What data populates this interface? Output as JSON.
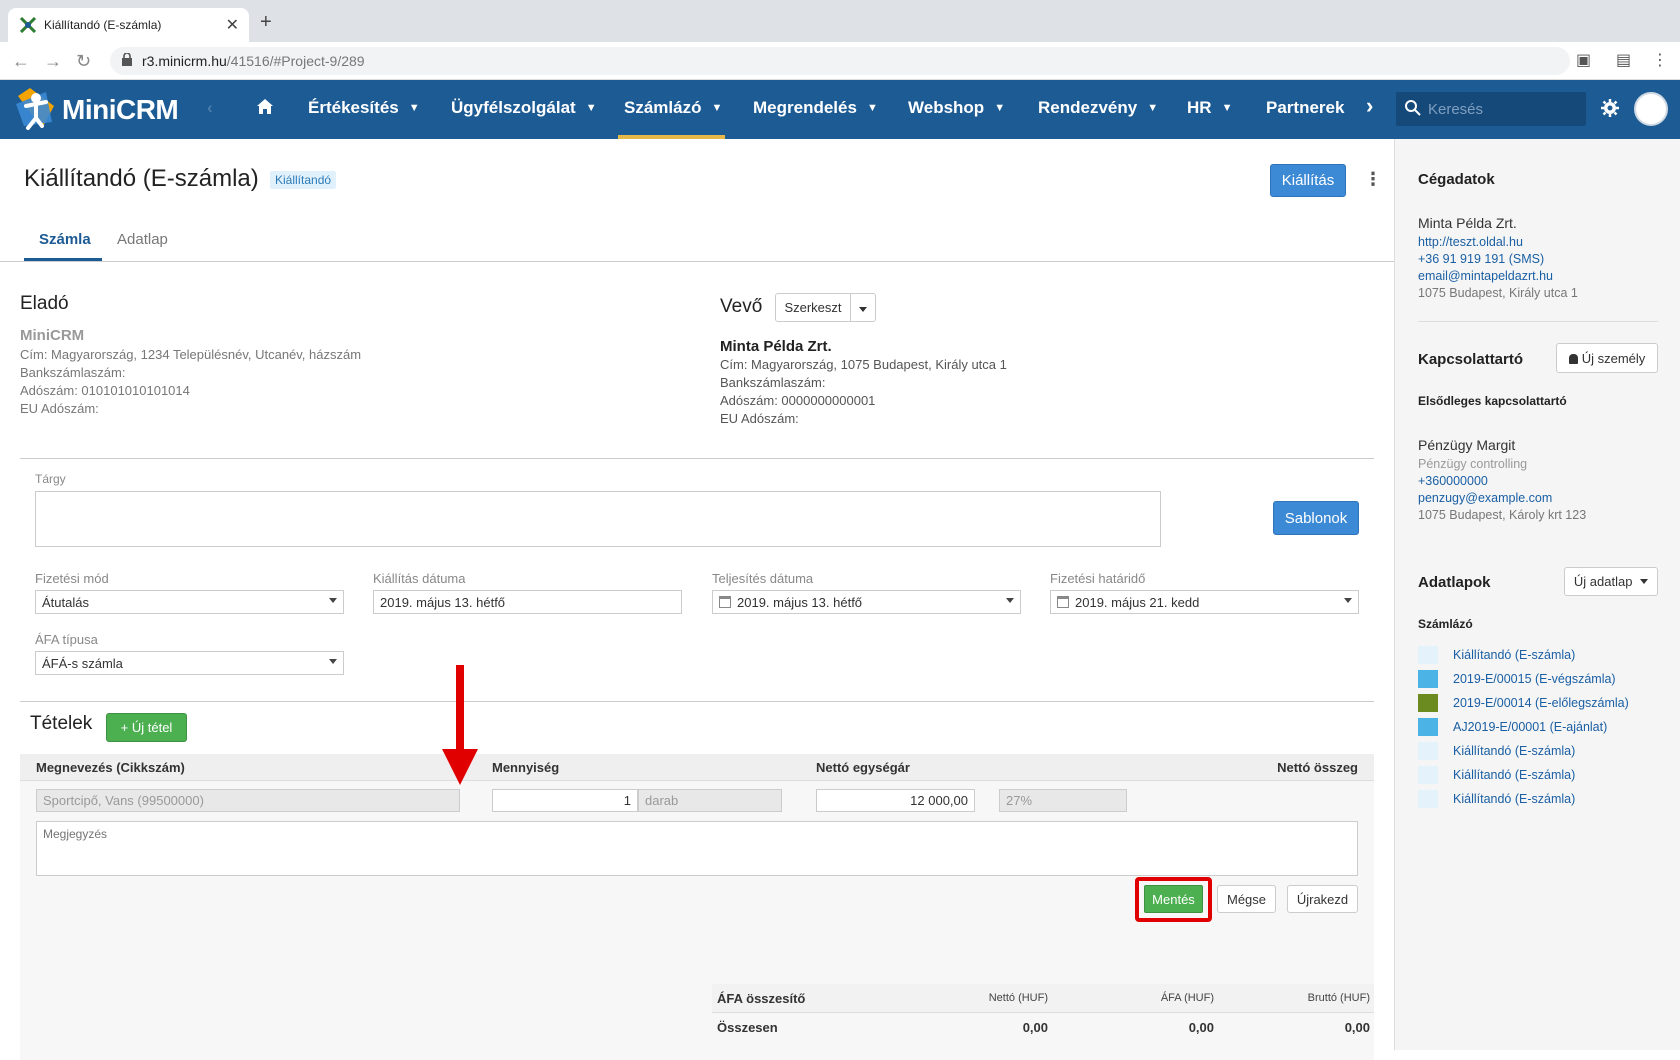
{
  "browser": {
    "tab_title": "Kiállítandó (E-számla)",
    "url_host": "r3.minicrm.hu",
    "url_path": "/41516/#Project-9/289"
  },
  "nav": {
    "logo": "MiniCRM",
    "items": [
      "Értékesítés",
      "Ügyfélszolgálat",
      "Számlázó",
      "Megrendelés",
      "Webshop",
      "Rendezvény",
      "HR",
      "Partnerek"
    ],
    "search_placeholder": "Keresés"
  },
  "page": {
    "title": "Kiállítandó (E-számla)",
    "status_badge": "Kiállítandó",
    "issue_button": "Kiállítás",
    "tabs": [
      "Számla",
      "Adatlap"
    ]
  },
  "seller": {
    "heading": "Eladó",
    "name": "MiniCRM",
    "address": "Cím: Magyarország, 1234 Településnév, Utcanév, házszám",
    "bank": "Bankszámlaszám:",
    "tax": "Adószám: 010101010101014",
    "eu_tax": "EU Adószám:"
  },
  "buyer": {
    "heading": "Vevő",
    "edit_button": "Szerkeszt",
    "name": "Minta Példa Zrt.",
    "address": "Cím: Magyarország, 1075 Budapest, Király utca 1",
    "bank": "Bankszámlaszám:",
    "tax": "Adószám: 0000000000001",
    "eu_tax": "EU Adószám:"
  },
  "form": {
    "subject_label": "Tárgy",
    "subject_value": "",
    "templates_button": "Sablonok",
    "payment_label": "Fizetési mód",
    "payment_value": "Átutalás",
    "issue_date_label": "Kiállítás dátuma",
    "issue_date_value": "2019. május 13. hétfő",
    "fulfil_date_label": "Teljesítés dátuma",
    "fulfil_date_value": "2019. május 13. hétfő",
    "due_label": "Fizetési határidő",
    "due_value": "2019. május 21. kedd",
    "vat_type_label": "ÁFA típusa",
    "vat_type_value": "ÁFÁ-s számla"
  },
  "items": {
    "heading": "Tételek",
    "new_item_button": "+ Új tétel",
    "col_name": "Megnevezés (Cikkszám)",
    "col_qty": "Mennyiség",
    "col_unit_price": "Nettó egységár",
    "col_net": "Nettó összeg",
    "row_name": "Sportcipő, Vans (99500000)",
    "row_qty": "1",
    "row_unit": "darab",
    "row_price": "12 000,00",
    "row_vat": "27%",
    "note_placeholder": "Megjegyzés",
    "save_button": "Mentés",
    "cancel_button": "Mégse",
    "recalc_button": "Újrakezd"
  },
  "summary": {
    "heading": "ÁFA összesítő",
    "col_net": "Nettó (HUF)",
    "col_vat": "ÁFA (HUF)",
    "col_gross": "Bruttó (HUF)",
    "total_label": "Összesen",
    "total_net": "0,00",
    "total_vat": "0,00",
    "total_gross": "0,00"
  },
  "sidebar": {
    "company_heading": "Cégadatok",
    "company_name": "Minta Példa Zrt.",
    "company_web": "http://teszt.oldal.hu",
    "company_phone": "+36 91 919 191 (SMS)",
    "company_email": "email@mintapeldazrt.hu",
    "company_address": "1075 Budapest, Király utca 1",
    "contact_heading": "Kapcsolattartó",
    "new_person_button": "Új személy",
    "primary_contact_label": "Elsődleges kapcsolattartó",
    "contact_name": "Pénzügy Margit",
    "contact_role": "Pénzügy controlling",
    "contact_phone": "+360000000",
    "contact_email": "penzugy@example.com",
    "contact_address": "1075 Budapest, Károly krt 123",
    "datasheets_heading": "Adatlapok",
    "new_datasheet_button": "Új adatlap",
    "invoicer_label": "Számlázó",
    "datasheets": [
      {
        "label": "Kiállítandó (E-számla)",
        "color": "#e3f2fb"
      },
      {
        "label": "2019-E/00015 (E-végszámla)",
        "color": "#4cb3e6"
      },
      {
        "label": "2019-E/00014 (E-előlegszámla)",
        "color": "#6b8a1f"
      },
      {
        "label": "AJ2019-E/00001 (E-ajánlat)",
        "color": "#4cb3e6"
      },
      {
        "label": "Kiállítandó (E-számla)",
        "color": "#e3f2fb"
      },
      {
        "label": "Kiállítandó (E-számla)",
        "color": "#e3f2fb"
      },
      {
        "label": "Kiállítandó (E-számla)",
        "color": "#e3f2fb"
      }
    ]
  },
  "colors": {
    "nav_bg": "#1d5b94",
    "primary": "#3c8ad5",
    "success": "#4caf50",
    "highlight": "#e00000"
  }
}
